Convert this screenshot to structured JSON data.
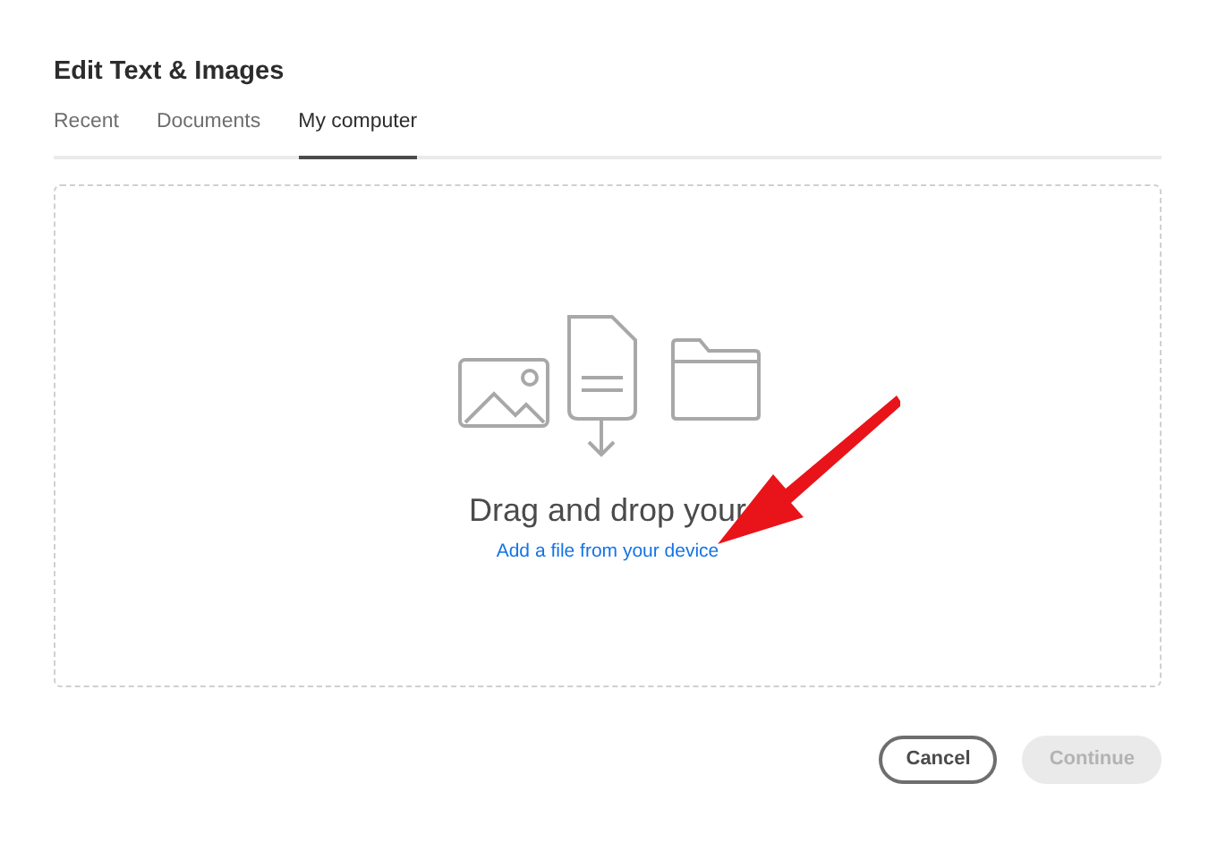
{
  "dialog": {
    "title": "Edit Text & Images"
  },
  "tabs": [
    {
      "label": "Recent",
      "selected": false
    },
    {
      "label": "Documents",
      "selected": false
    },
    {
      "label": "My computer",
      "selected": true
    }
  ],
  "dropzone": {
    "heading": "Drag and drop your",
    "link": "Add a file from your device"
  },
  "buttons": [
    {
      "label": "Cancel",
      "kind": "secondary",
      "disabled": false
    },
    {
      "label": "Continue",
      "kind": "primary",
      "disabled": true
    }
  ]
}
